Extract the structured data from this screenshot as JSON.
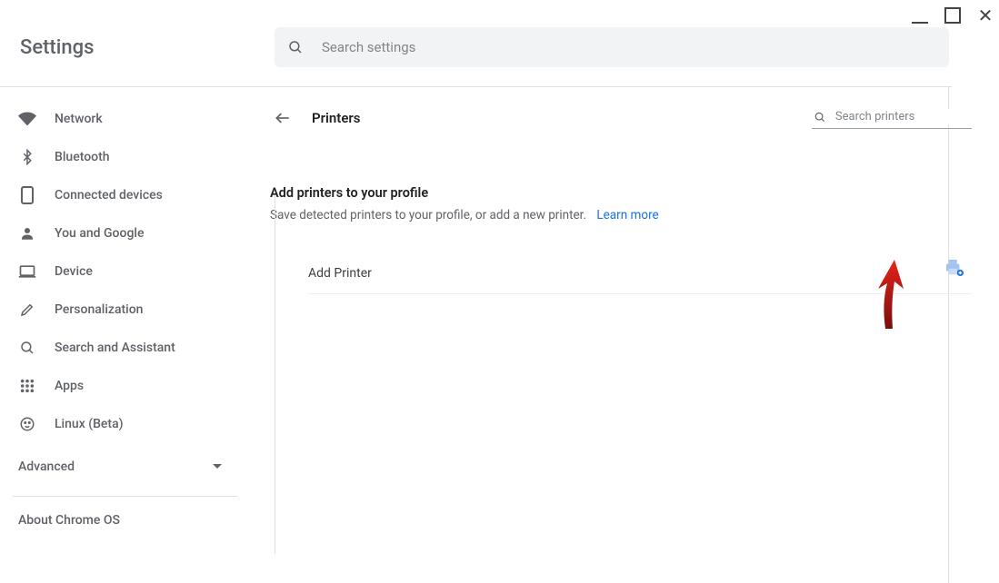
{
  "window": {
    "app_title": "Settings"
  },
  "search": {
    "placeholder": "Search settings"
  },
  "sidebar": {
    "items": [
      {
        "label": "Network"
      },
      {
        "label": "Bluetooth"
      },
      {
        "label": "Connected devices"
      },
      {
        "label": "You and Google"
      },
      {
        "label": "Device"
      },
      {
        "label": "Personalization"
      },
      {
        "label": "Search and Assistant"
      },
      {
        "label": "Apps"
      },
      {
        "label": "Linux (Beta)"
      }
    ],
    "advanced_label": "Advanced",
    "about_label": "About Chrome OS"
  },
  "page": {
    "title": "Printers",
    "search_placeholder": "Search printers",
    "section_title": "Add printers to your profile",
    "section_desc": "Save detected printers to your profile, or add a new printer.",
    "learn_more": "Learn more",
    "add_printer_label": "Add Printer"
  },
  "colors": {
    "link": "#1a73e8",
    "muted": "#5f6368",
    "arrow": "#c4161c"
  }
}
